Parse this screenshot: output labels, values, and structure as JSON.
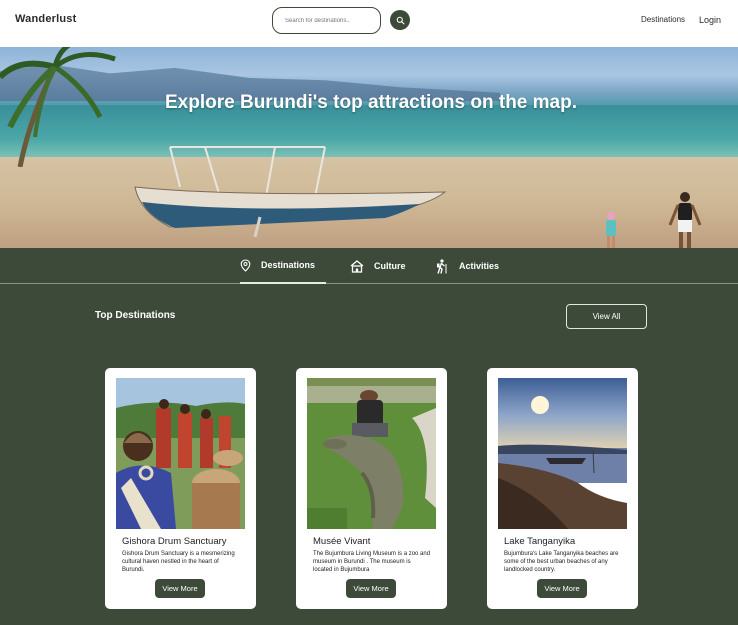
{
  "header": {
    "brand": "Wanderlust",
    "search_placeholder": "Search for destinations..",
    "nav": {
      "destinations": "Destinations",
      "login": "Login"
    }
  },
  "hero": {
    "title": "Explore Burundi's top attractions on the map."
  },
  "tabs": [
    {
      "label": "Destinations",
      "icon": "map-pin-icon",
      "active": true
    },
    {
      "label": "Culture",
      "icon": "hut-icon",
      "active": false
    },
    {
      "label": "Activities",
      "icon": "hiker-icon",
      "active": false
    }
  ],
  "section": {
    "title": "Top Destinations",
    "view_all": "View All"
  },
  "cards": [
    {
      "title": "Gishora Drum Sanctuary",
      "description": "Gishora Drum Sanctuary is a mesmerizing cultural haven nestled in the heart of Burundi.",
      "button": "View More"
    },
    {
      "title": "Musée Vivant",
      "description": "The Bujumbura Living Museum is a zoo and museum in Burundi . The museum is located in Bujumbura",
      "button": "View More"
    },
    {
      "title": "Lake Tanganyika",
      "description": "Bujumbura's Lake Tanganyika beaches are some of the best urban beaches of any landlocked country.",
      "button": "View More"
    }
  ],
  "colors": {
    "primary": "#3d4a3a",
    "header_bg": "#ffffff",
    "card_bg": "#ffffff"
  }
}
